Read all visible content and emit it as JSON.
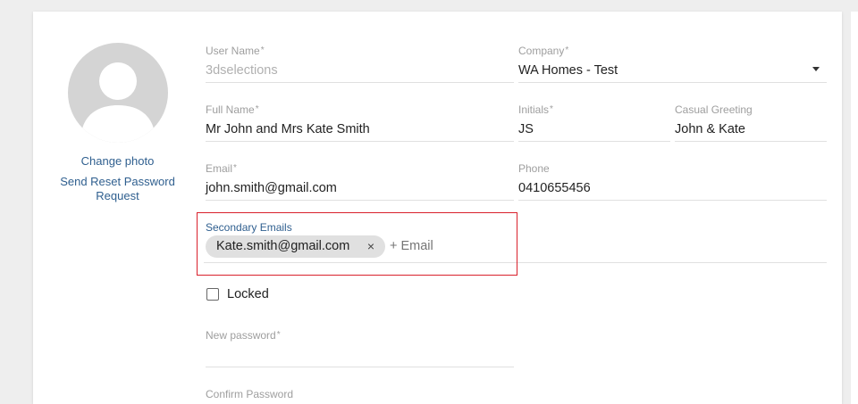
{
  "profile": {
    "change_photo": "Change photo",
    "reset_password_line1": "Send Reset Password",
    "reset_password_line2": "Request"
  },
  "fields": {
    "user_name": {
      "label": "User Name",
      "value": "3dselections"
    },
    "company": {
      "label": "Company",
      "value": "WA Homes - Test"
    },
    "full_name": {
      "label": "Full Name",
      "value": "Mr John and Mrs Kate Smith"
    },
    "initials": {
      "label": "Initials",
      "value": "JS"
    },
    "casual_greeting": {
      "label": "Casual Greeting",
      "value": "John & Kate"
    },
    "email": {
      "label": "Email",
      "value": "john.smith@gmail.com"
    },
    "phone": {
      "label": "Phone",
      "value": "0410655456"
    },
    "new_password": {
      "label": "New password",
      "value": ""
    },
    "confirm_password": {
      "label": "Confirm Password"
    }
  },
  "secondary_emails": {
    "label": "Secondary Emails",
    "chips": [
      "Kate.smith@gmail.com"
    ],
    "add_placeholder": "+ Email",
    "remove_icon": "×"
  },
  "locked": {
    "label": "Locked",
    "checked": false
  },
  "required_marker": "*",
  "colors": {
    "link": "#2f5f8f",
    "highlight_border": "#d9212c",
    "chip_bg": "#e0e0e0"
  }
}
